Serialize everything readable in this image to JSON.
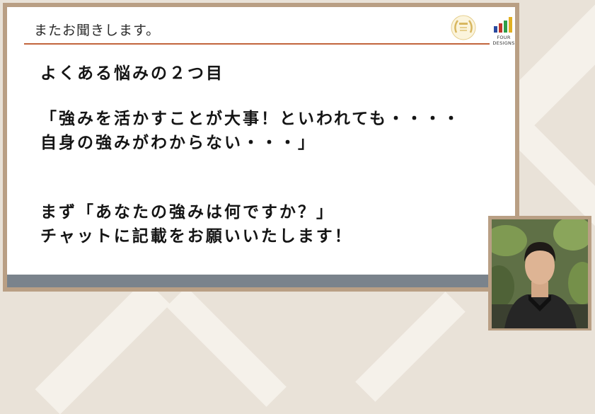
{
  "slide": {
    "header": "またお聞きします。",
    "logo": {
      "brand": "FOUR DESIGNS",
      "bar_colors": [
        "#2a4aa0",
        "#c0392b",
        "#2e9e48",
        "#e2b022"
      ]
    },
    "lines": [
      "よくある悩みの２つ目",
      "「強みを活かすことが大事！といわれても・・・・",
      "自身の強みがわからない・・・」",
      "まず「あなたの強みは何ですか？」",
      "チャットに記載をお願いいたします！"
    ]
  },
  "colors": {
    "accent_line": "#c2653c",
    "footer": "#7a838c",
    "frame": "#b99f84"
  }
}
